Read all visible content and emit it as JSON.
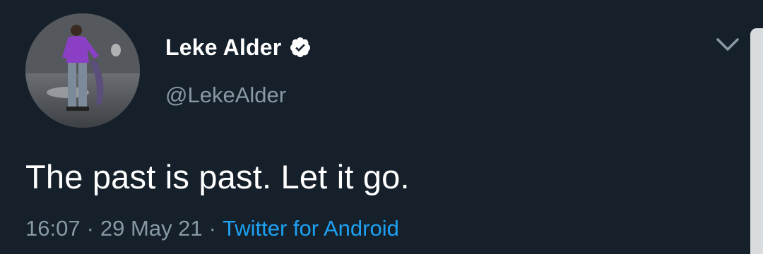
{
  "tweet": {
    "display_name": "Leke Alder",
    "handle": "@LekeAlder",
    "text": "The past is past. Let it go.",
    "time": "16:07",
    "date": "29 May 21",
    "separator": "·",
    "source": "Twitter for Android",
    "verified_icon": "verified-badge-icon",
    "menu_icon": "chevron-down-icon"
  },
  "colors": {
    "background": "#15202b",
    "primary_text": "#ffffff",
    "secondary_text": "#8899a6",
    "link": "#1da1f2"
  }
}
